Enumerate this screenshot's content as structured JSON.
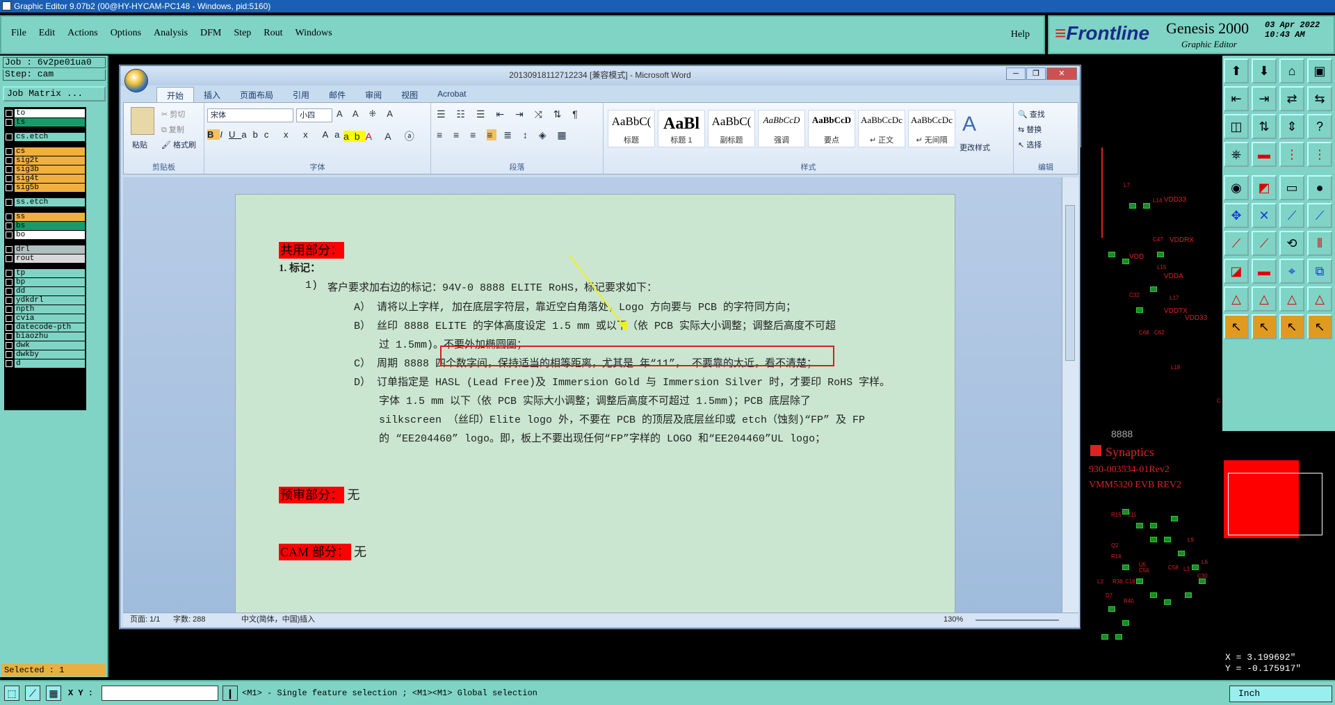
{
  "app": {
    "title": "Graphic Editor 9.07b2 (00@HY-HYCAM-PC148 - Windows, pid:5160)",
    "menus": [
      "File",
      "Edit",
      "Actions",
      "Options",
      "Analysis",
      "DFM",
      "Step",
      "Rout",
      "Windows"
    ],
    "help": "Help",
    "brand_logo": "Frontline",
    "brand_title": "Genesis 2000",
    "brand_sub": "Graphic Editor",
    "date_line1": "03 Apr 2022",
    "date_line2": "10:43 AM"
  },
  "job": {
    "job_line": "Job : 6v2pe01ua0",
    "step_line": "Step: cam",
    "job_matrix": "Job Matrix ..."
  },
  "layers": [
    {
      "name": "to",
      "bg": "#ffffff",
      "group": 1
    },
    {
      "name": "ts",
      "bg": "#1a9a6a",
      "group": 1
    },
    {
      "name": "cs.etch",
      "bg": "#7fd4c5",
      "group": 2
    },
    {
      "name": "cs",
      "bg": "#f0b040",
      "group": 3
    },
    {
      "name": "sig2t",
      "bg": "#f0b040",
      "group": 3
    },
    {
      "name": "sig3b",
      "bg": "#f0b040",
      "group": 3
    },
    {
      "name": "sig4t",
      "bg": "#f0b040",
      "group": 3
    },
    {
      "name": "sig5b",
      "bg": "#f0b040",
      "group": 3
    },
    {
      "name": "ss.etch",
      "bg": "#7fd4c5",
      "group": 4
    },
    {
      "name": "ss",
      "bg": "#f0b040",
      "group": 5
    },
    {
      "name": "bs",
      "bg": "#1a9a6a",
      "group": 5
    },
    {
      "name": "bo",
      "bg": "#ffffff",
      "group": 5
    },
    {
      "name": "drl",
      "bg": "#b0c0c0",
      "group": 6
    },
    {
      "name": "rout",
      "bg": "#d8d8d8",
      "group": 6
    },
    {
      "name": "tp",
      "bg": "#7fd4c5",
      "group": 7
    },
    {
      "name": "bp",
      "bg": "#7fd4c5",
      "group": 7
    },
    {
      "name": "dd",
      "bg": "#7fd4c5",
      "group": 7
    },
    {
      "name": "ydkdrl",
      "bg": "#7fd4c5",
      "group": 7
    },
    {
      "name": "npth",
      "bg": "#7fd4c5",
      "group": 7
    },
    {
      "name": "cvia",
      "bg": "#7fd4c5",
      "group": 7
    },
    {
      "name": "datecode-pth",
      "bg": "#7fd4c5",
      "group": 7
    },
    {
      "name": "biaozhu",
      "bg": "#7fd4c5",
      "group": 7
    },
    {
      "name": "dwk",
      "bg": "#7fd4c5",
      "group": 7
    },
    {
      "name": "dwkby",
      "bg": "#7fd4c5",
      "group": 7
    },
    {
      "name": "d",
      "bg": "#7fd4c5",
      "group": 7
    }
  ],
  "selected": "Selected : 1",
  "bottom": {
    "xy_label": "X Y :",
    "xy_value": "",
    "info": "<M1> - Single feature selection ; <M1><M1> Global selection",
    "unit": "Inch"
  },
  "coords": {
    "x": "X = 3.199692\"",
    "y": "Y = -0.175917\""
  },
  "pcb": {
    "synaptics": "Synaptics",
    "part_no": "930-003534-01Rev2",
    "board": "VMM5320 EVB REV2",
    "code": "8888",
    "labels": [
      "VDD33",
      "VDDRX",
      "VDD",
      "VDDA",
      "VDDTX",
      "VDD33",
      "L7",
      "L14",
      "C47",
      "L15",
      "C32",
      "L17",
      "C68",
      "C62",
      "L18",
      "C36",
      "R15",
      "J11",
      "Q2",
      "R16",
      "L2",
      "C58",
      "C56",
      "L3",
      "U5",
      "C18",
      "L6",
      "C30",
      "L9",
      "R38",
      "D7",
      "R40"
    ]
  },
  "word": {
    "title": "20130918112712234 [兼容模式] - Microsoft Word",
    "tabs": [
      "开始",
      "插入",
      "页面布局",
      "引用",
      "邮件",
      "审阅",
      "视图",
      "Acrobat"
    ],
    "clipboard": {
      "paste": "粘贴",
      "cut": "剪切",
      "copy": "复制",
      "format": "格式刷",
      "label": "剪贴板"
    },
    "font": {
      "name": "宋体",
      "size": "小四",
      "label": "字体"
    },
    "paragraph_label": "段落",
    "styles": [
      {
        "preview": "AaBbC(",
        "name": "标题"
      },
      {
        "preview": "AaBl",
        "name": "标题 1"
      },
      {
        "preview": "AaBbC(",
        "name": "副标题"
      },
      {
        "preview": "AaBbCcD",
        "name": "强调"
      },
      {
        "preview": "AaBbCcD",
        "name": "要点"
      },
      {
        "preview": "AaBbCcDc",
        "name": "↵ 正文"
      },
      {
        "preview": "AaBbCcDc",
        "name": "↵ 无间隔"
      }
    ],
    "change_styles": "更改样式",
    "styles_label": "样式",
    "edit": {
      "find": "查找",
      "replace": "替换",
      "select": "选择",
      "label": "编辑"
    },
    "doc": {
      "h_common": "共用部分：",
      "item1": "1.   标记：",
      "sub1": "1)",
      "req": "客户要求加右边的标记：94V-0  8888  ELITE RoHS，标记要求如下：",
      "a": "A）  请将以上字样, 加在底层字符层，靠近空白角落处，Logo 方向要与 PCB  的字符同方向；",
      "b1": "B）  丝印 8888  ELITE   的字体高度设定 1.5 mm 或以下（依 PCB 实际大小调整；调整后高度不可超",
      "b2": "过 1.5mm)。不要外加椭圆圈；",
      "c": "C）  周期 8888 四个数字间，保持适当的相等距离，尤其是  年“11”， 不要靠的太近，看不清楚；",
      "d1": "D）  订单指定是 HASL (Lead Free)及 Immersion Gold 与 Immersion Silver 时，才要印 RoHS 字样。",
      "d2": "字体 1.5 mm 以下（依 PCB 实际大小调整；调整后高度不可超过 1.5mm)；PCB  底层除了",
      "d3": "silkscreen （丝印）Elite logo 外，不要在 PCB 的顶层及底层丝印或 etch（蚀刻)“FP”  及 FP",
      "d4": "的 “EE204460” logo。即，板上不要出现任何“FP”字样的 LOGO 和“EE204460”UL  logo；",
      "h_pre": "预审部分：",
      "pre_val": "无",
      "h_cam": "CAM 部分：",
      "cam_val": "无"
    },
    "status": {
      "page": "页面: 1/1",
      "words": "字数: 288",
      "lang": "中文(简体，中国)",
      "mode": "插入",
      "zoom": "130%"
    }
  }
}
